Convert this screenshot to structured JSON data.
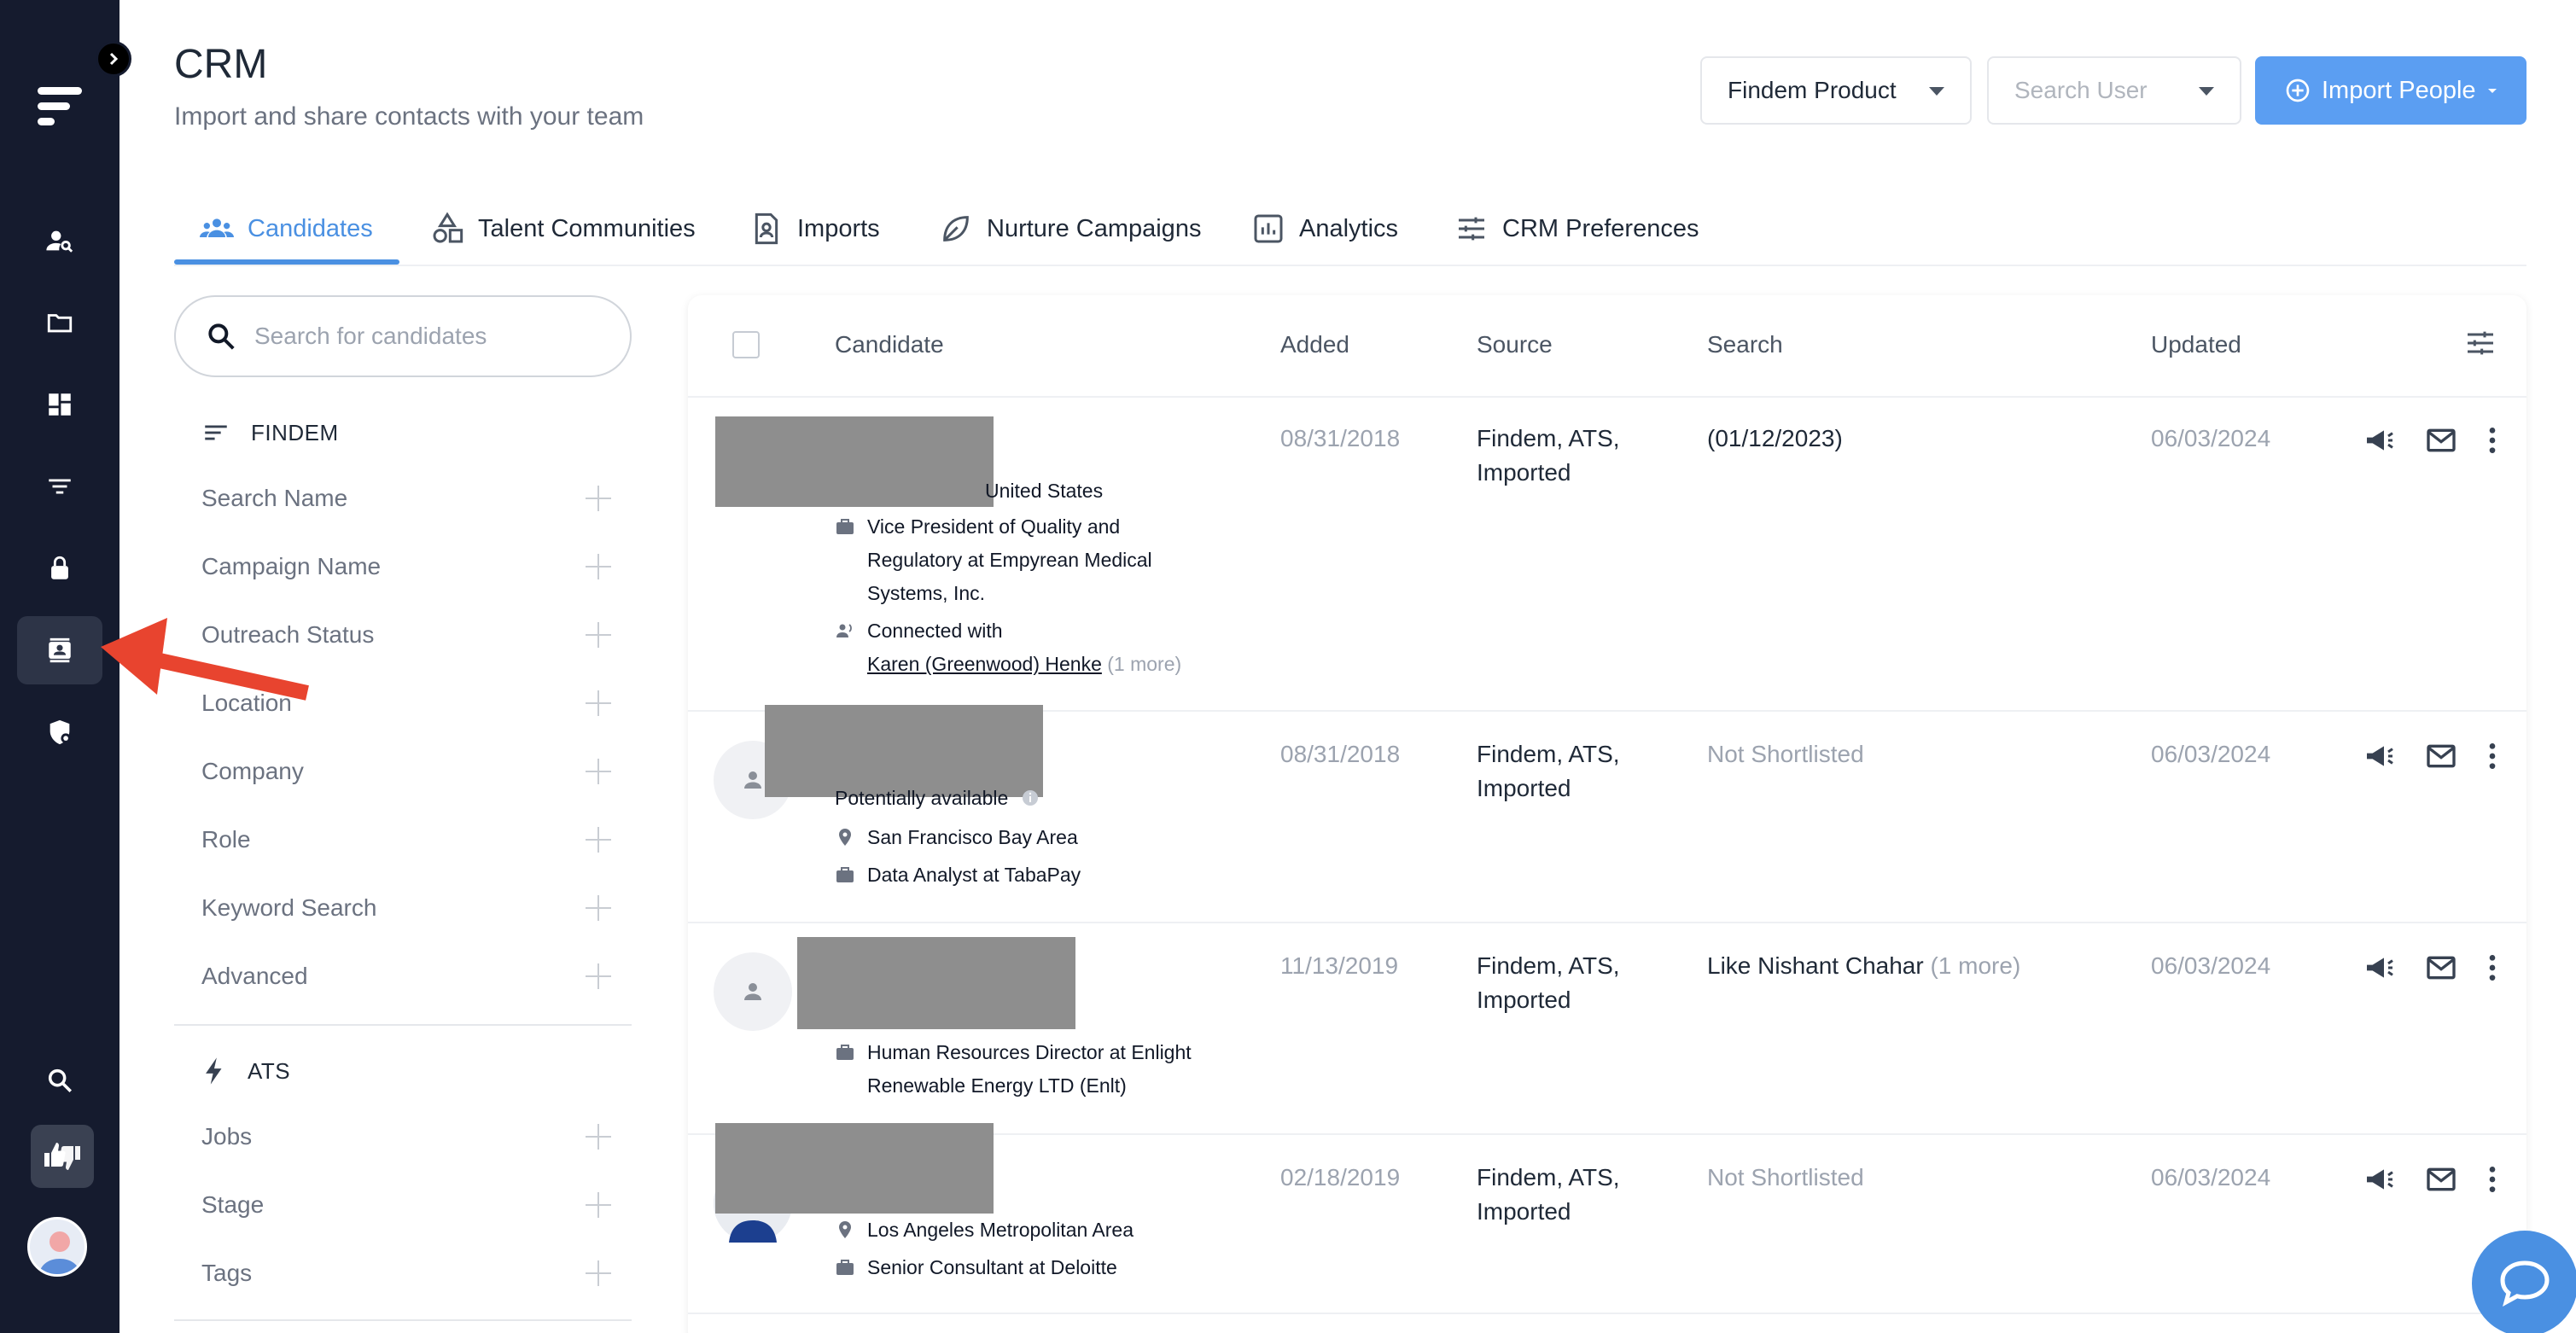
{
  "header": {
    "title": "CRM",
    "subtitle": "Import and share contacts with your team",
    "product_select": "Findem Product",
    "user_search_placeholder": "Search User",
    "import_button": "Import People"
  },
  "tabs": [
    {
      "label": "Candidates"
    },
    {
      "label": "Talent Communities"
    },
    {
      "label": "Imports"
    },
    {
      "label": "Nurture Campaigns"
    },
    {
      "label": "Analytics"
    },
    {
      "label": "CRM Preferences"
    }
  ],
  "filters": {
    "search_placeholder": "Search for candidates",
    "findem_header": "FINDEM",
    "findem_items": [
      "Search Name",
      "Campaign Name",
      "Outreach Status",
      "Location",
      "Company",
      "Role",
      "Keyword Search",
      "Advanced"
    ],
    "ats_header": "ATS",
    "ats_items": [
      "Jobs",
      "Stage",
      "Tags"
    ]
  },
  "table": {
    "columns": [
      "Candidate",
      "Added",
      "Source",
      "Search",
      "Updated"
    ],
    "rows": [
      {
        "location": "United States",
        "role": "Vice President of Quality and Regulatory at Empyrean Medical Systems, Inc.",
        "role_lines": [
          "Vice President of Quality and",
          "Regulatory at Empyrean Medical",
          "Systems, Inc."
        ],
        "connected_label": "Connected with",
        "connected_name": "Karen (Greenwood) Henke",
        "connected_more": "(1 more)",
        "added": "08/31/2018",
        "source_lines": [
          "Findem, ATS,",
          "Imported"
        ],
        "search": "(01/12/2023)",
        "updated": "06/03/2024"
      },
      {
        "availability": "Potentially available",
        "location": "San Francisco Bay Area",
        "role": "Data Analyst at TabaPay",
        "added": "08/31/2018",
        "source_lines": [
          "Findem, ATS,",
          "Imported"
        ],
        "search": "Not Shortlisted",
        "updated": "06/03/2024"
      },
      {
        "role_lines": [
          "Human Resources Director at Enlight",
          "Renewable Energy LTD (Enlt)"
        ],
        "added": "11/13/2019",
        "source_lines": [
          "Findem, ATS,",
          "Imported"
        ],
        "search": "Like Nishant Chahar",
        "search_more": "(1 more)",
        "updated": "06/03/2024"
      },
      {
        "location": "Los Angeles Metropolitan Area",
        "role": "Senior Consultant at Deloitte",
        "added": "02/18/2019",
        "source_lines": [
          "Findem, ATS,",
          "Imported"
        ],
        "search": "Not Shortlisted",
        "updated": "06/03/2024"
      }
    ]
  },
  "colors": {
    "sidebar_bg": "#151b2e",
    "accent": "#4a90e2",
    "import_button": "#5b9ef2",
    "redaction": "#8e8e8e",
    "arrow": "#e8442f"
  }
}
